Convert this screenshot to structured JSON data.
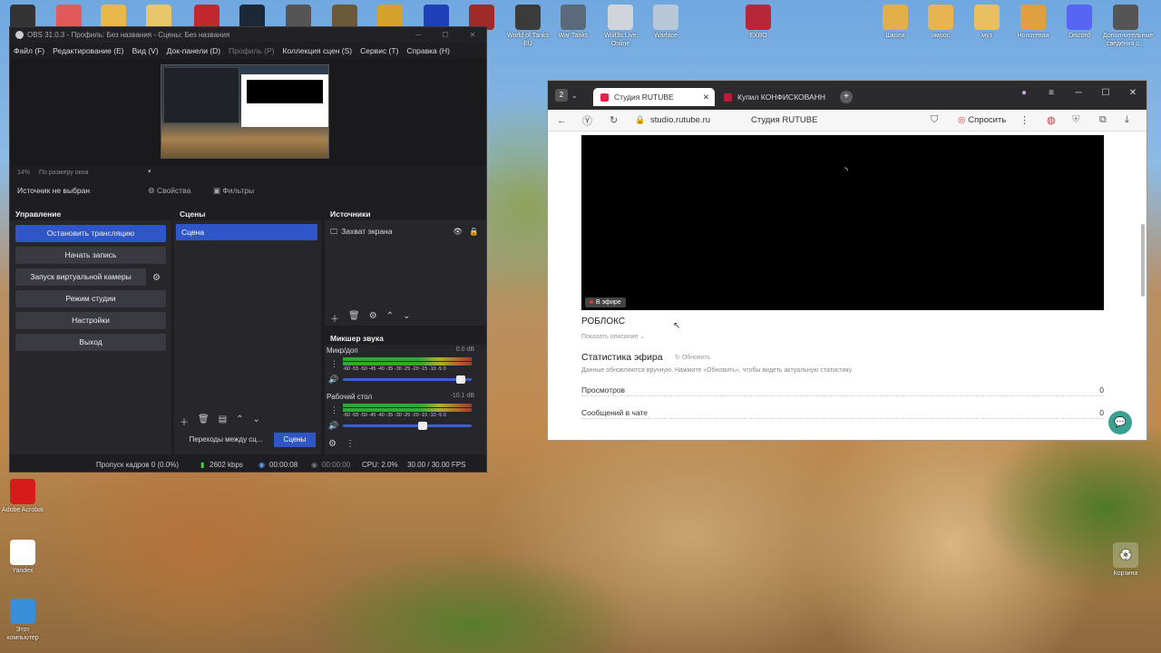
{
  "desktop": {
    "top_icons": [
      {
        "label": "",
        "icon": "obs-icon",
        "color": "#333"
      },
      {
        "label": "",
        "icon": "app-icon",
        "color": "#e05a5a"
      },
      {
        "label": "",
        "icon": "folder-icon",
        "color": "#e8b94a"
      },
      {
        "label": "",
        "icon": "folder-icon",
        "color": "#e8c66a"
      },
      {
        "label": "",
        "icon": "opera-icon",
        "color": "#c0282e"
      },
      {
        "label": "",
        "icon": "steam-icon",
        "color": "#1b2838"
      },
      {
        "label": "",
        "icon": "game-icon",
        "color": "#555"
      },
      {
        "label": "",
        "icon": "game-icon",
        "color": "#6b5a3a"
      },
      {
        "label": "",
        "icon": "game-icon",
        "color": "#d4a22a"
      },
      {
        "label": "",
        "icon": "xbox-icon",
        "color": "#1e3fb7"
      },
      {
        "label": "",
        "icon": "game-icon",
        "color": "#a02a2a"
      },
      {
        "label": "World of Tanks EU",
        "icon": "wot-icon",
        "color": "#3b3b3b"
      },
      {
        "label": "War Tanks",
        "icon": "tanks-icon",
        "color": "#5a6a7a"
      },
      {
        "label": "Wiiif3s Live Online",
        "icon": "game-icon",
        "color": "#cfd5da"
      },
      {
        "label": "Warface",
        "icon": "warface-icon",
        "color": "#b8c8d8"
      },
      {
        "label": "EXBO",
        "icon": "exbo-icon",
        "color": "#b8263a"
      },
      {
        "label": "Школа",
        "icon": "folder-icon",
        "color": "#e2b04a"
      },
      {
        "label": "имоос",
        "icon": "folder-icon",
        "color": "#e6b450"
      },
      {
        "label": "муз",
        "icon": "folder-icon",
        "color": "#e8c060"
      },
      {
        "label": "Нопотевая",
        "icon": "folder-icon",
        "color": "#e0a040"
      },
      {
        "label": "Discord",
        "icon": "discord-icon",
        "color": "#5865f2"
      },
      {
        "label": "Дополнительные сведения о...",
        "icon": "info-icon",
        "color": "#555"
      }
    ],
    "left_icons": [
      {
        "label": "Adobe Acrobat",
        "icon": "acrobat-icon",
        "color": "#d61b1b"
      },
      {
        "label": "Yandex",
        "icon": "yandex-icon",
        "color": "#ffffff"
      },
      {
        "label": "Этот компьютер",
        "icon": "computer-icon",
        "color": "#3a8ed8"
      }
    ],
    "trash": {
      "label": "Корзина",
      "icon": "recycle-bin-icon"
    }
  },
  "obs": {
    "title": "OBS 31.0.3 - Профиль: Без названия - Сцены: Без названия",
    "menu": [
      "Файл (F)",
      "Редактирование (E)",
      "Вид (V)",
      "Док-панели (D)",
      "Профиль (P)",
      "Коллекция сцен (S)",
      "Сервис (T)",
      "Справка (H)"
    ],
    "zoom": "14%",
    "zoom_mode": "По размеру окна",
    "no_source": "Источник не выбран",
    "properties": "Свойства",
    "filters": "Фильтры",
    "controls_header": "Управление",
    "controls": [
      "Остановить трансляцию",
      "Начать запись",
      "Запуск виртуальной камеры",
      "Режим студии",
      "Настройки",
      "Выход"
    ],
    "scenes_header": "Сцены",
    "scenes": [
      "Сцена"
    ],
    "sources_header": "Источники",
    "sources": [
      "Захват экрана"
    ],
    "mixer_header": "Микшер звука",
    "mixer": [
      {
        "name": "Микр/доп",
        "db": "0.0 dB",
        "volume": 0.95
      },
      {
        "name": "Рабочий стол",
        "db": "-10.1 dB",
        "volume": 0.63
      }
    ],
    "meter_scale": "-60 -55 -50 -45 -40 -35 -30 -25 -20 -15 -10 -5 0",
    "transitions_tab": "Переходы между сц...",
    "scenes_tab": "Сцены",
    "status": {
      "dropped": "Пропуск кадров 0 (0.0%)",
      "bitrate": "2602 kbps",
      "stream_time": "00:00:08",
      "rec_time": "00:00:00",
      "cpu": "CPU: 2.0%",
      "fps": "30.00 / 30.00 FPS"
    }
  },
  "browser": {
    "tab_count": "2",
    "tabs": [
      {
        "title": "Студия RUTUBE",
        "active": true
      },
      {
        "title": "Купил КОНФИСКОВАНН",
        "active": false
      }
    ],
    "url": "studio.rutube.ru",
    "page_title": "Студия RUTUBE",
    "ask_button": "Спросить",
    "live_badge": "В эфире",
    "stream_title": "РОБЛОКС",
    "show_description": "Показать описание",
    "stats_title": "Статистика эфира",
    "refresh": "Обновить",
    "stats_note": "Данные обновляются вручную. Нажмите «Обновить», чтобы видеть актуальную статистику",
    "stats": [
      {
        "label": "Просмотров",
        "value": "0"
      },
      {
        "label": "Сообщений в чате",
        "value": "0"
      }
    ]
  }
}
